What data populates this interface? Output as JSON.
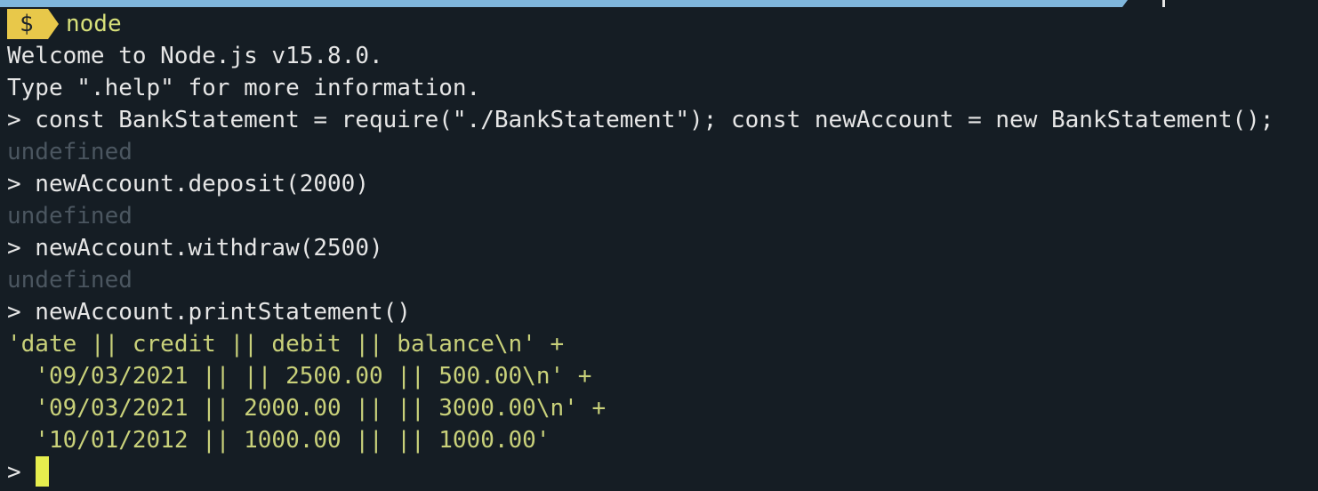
{
  "shell": {
    "prompt_symbol": "$",
    "command": "node"
  },
  "output": {
    "lines": [
      "Welcome to Node.js v15.8.0.",
      "Type \".help\" for more information.",
      "> const BankStatement = require(\"./BankStatement\"); const newAccount = new BankStatement();",
      "undefined",
      "> newAccount.deposit(2000)",
      "undefined",
      "> newAccount.withdraw(2500)",
      "undefined",
      "> newAccount.printStatement()",
      "'date || credit || debit || balance\\n' +",
      "  '09/03/2021 || || 2500.00 || 500.00\\n' +",
      "  '09/03/2021 || 2000.00 || || 3000.00\\n' +",
      "  '10/01/2012 || 1000.00 || || 1000.00'"
    ],
    "repl_prompt": ">"
  },
  "colors": {
    "background": "#151d24",
    "path_segment": "#7fb6dc",
    "prompt_badge": "#e8c84a",
    "text": "#e6e6e6",
    "dim_text": "#4b5660",
    "string_text": "#c9d17a",
    "cursor": "#e6ee4e"
  }
}
